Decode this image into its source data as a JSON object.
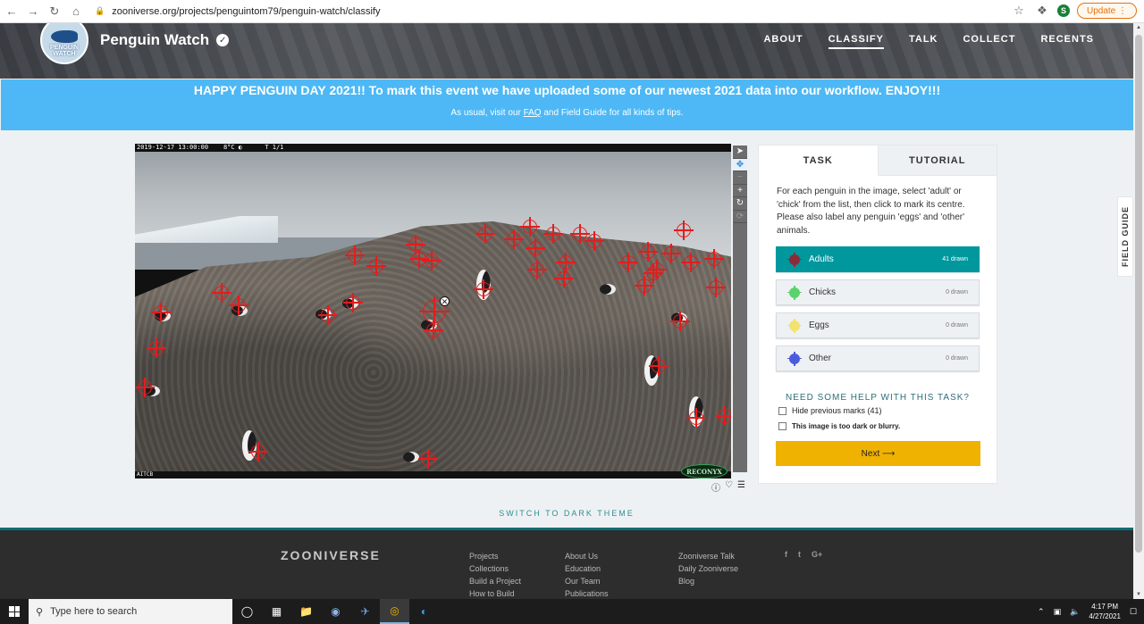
{
  "browser": {
    "url": "zooniverse.org/projects/penguintom79/penguin-watch/classify",
    "update_label": "Update",
    "profile_initial": "S"
  },
  "project": {
    "title": "Penguin Watch",
    "logo_line1": "PENGUIN",
    "logo_line2": "WATCH",
    "nav": [
      "ABOUT",
      "CLASSIFY",
      "TALK",
      "COLLECT",
      "RECENTS"
    ]
  },
  "announcement": {
    "headline": "HAPPY PENGUIN DAY 2021!! To mark this event we have uploaded some of our newest 2021 data into our workflow. ENJOY!!!",
    "sub_before": "As usual, visit our ",
    "sub_faq": "FAQ",
    "sub_after": " and Field Guide for all kinds of tips."
  },
  "subject": {
    "timestamp": "2019-12-17 13:00:00",
    "temp": "8°C",
    "frame": "T 1/1",
    "camera_id": "AITCB",
    "brand": "RECONYX"
  },
  "task_panel": {
    "tabs": [
      "TASK",
      "TUTORIAL"
    ],
    "instructions": "For each penguin in the image, select 'adult' or 'chick' from the list, then click to mark its centre. Please also label any penguin 'eggs' and 'other' animals.",
    "options": [
      {
        "label": "Adults",
        "count": "41 drawn",
        "color": "#8a2b3a"
      },
      {
        "label": "Chicks",
        "count": "0 drawn",
        "color": "#5ad46a"
      },
      {
        "label": "Eggs",
        "count": "0 drawn",
        "color": "#f1e36f"
      },
      {
        "label": "Other",
        "count": "0 drawn",
        "color": "#4a5be0"
      }
    ],
    "help_title": "NEED SOME HELP WITH THIS TASK?",
    "hide_marks": "Hide previous marks (41)",
    "too_dark": "This image is too dark or blurry.",
    "next_label": "Next ⟶"
  },
  "field_guide": "FIELD GUIDE",
  "switch_theme": "SWITCH TO DARK THEME",
  "footer": {
    "logo": "ZOONIVERSE",
    "col1": [
      "Projects",
      "Collections",
      "Build a Project",
      "How to Build"
    ],
    "col2": [
      "About Us",
      "Education",
      "Our Team",
      "Publications"
    ],
    "col3": [
      "Zooniverse Talk",
      "Daily Zooniverse",
      "Blog"
    ],
    "social": [
      "f",
      "t",
      "G+"
    ]
  },
  "taskbar": {
    "search_placeholder": "Type here to search",
    "time": "4:17 PM",
    "date": "4/27/2021"
  },
  "colors": {
    "accent_teal": "#00979d",
    "announce_blue": "#4db8f5",
    "next_yellow": "#f0b200",
    "mark_red": "#e31d1d"
  }
}
